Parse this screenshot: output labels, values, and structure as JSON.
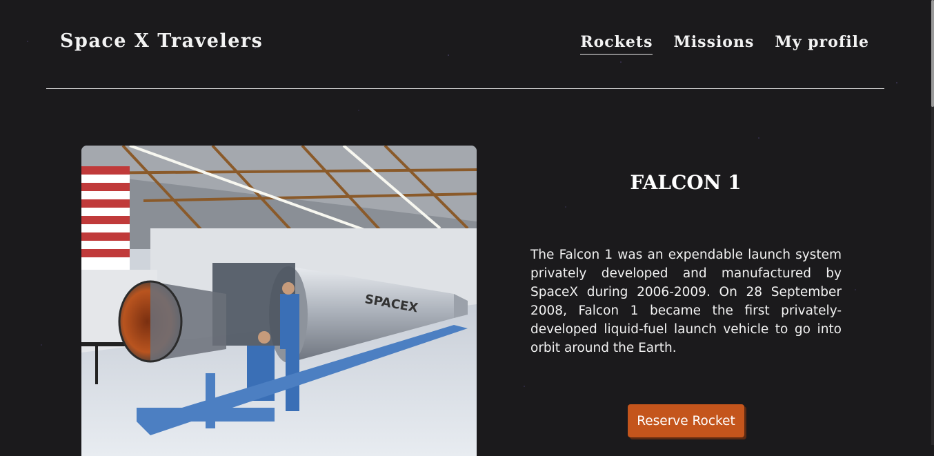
{
  "header": {
    "logo": "Space X Travelers",
    "nav": [
      {
        "label": "Rockets",
        "active": true
      },
      {
        "label": "Missions",
        "active": false
      },
      {
        "label": "My profile",
        "active": false
      }
    ]
  },
  "rocket": {
    "name": "FALCON 1",
    "description": "The Falcon 1 was an expendable launch system privately developed and manufactured by SpaceX during 2006-2009. On 28 September 2008, Falcon 1 became the first privately-developed liquid-fuel launch vehicle to go into orbit around the Earth.",
    "image_alt": "Falcon 1 rocket in hangar",
    "reserve_label": "Reserve Rocket",
    "body_lettering": "SPACEX"
  },
  "colors": {
    "background": "#1b1a1c",
    "button": "#c4551c",
    "text": "#ffffff"
  }
}
